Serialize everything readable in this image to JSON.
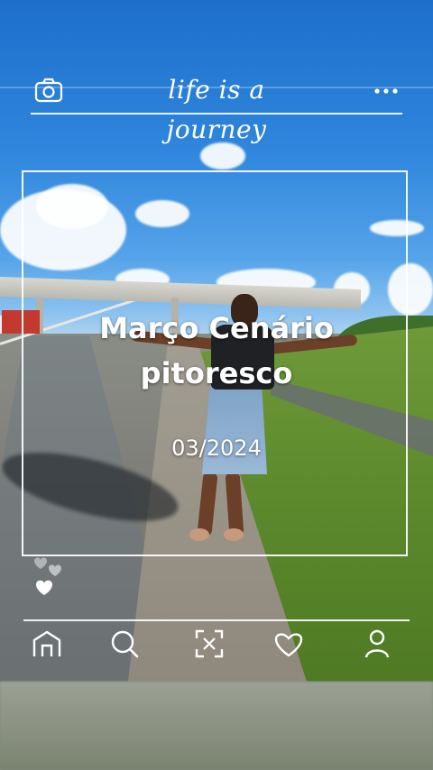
{
  "header": {
    "brand_text": "life is a journey",
    "camera_icon": "camera-icon",
    "more_icon": "more-dots-icon"
  },
  "caption": {
    "line1": "Março Cenário",
    "line2": "pitoresco",
    "date": "03/2024"
  },
  "floating": {
    "icon": "heart-icon"
  },
  "nav": {
    "items": [
      {
        "icon": "home-icon"
      },
      {
        "icon": "search-icon"
      },
      {
        "icon": "scan-icon"
      },
      {
        "icon": "heart-outline-icon"
      },
      {
        "icon": "profile-icon"
      }
    ]
  },
  "colors": {
    "sky_top": "#1d6fcb",
    "overlay_line": "#ffffff",
    "grass": "#5f8c2e"
  }
}
